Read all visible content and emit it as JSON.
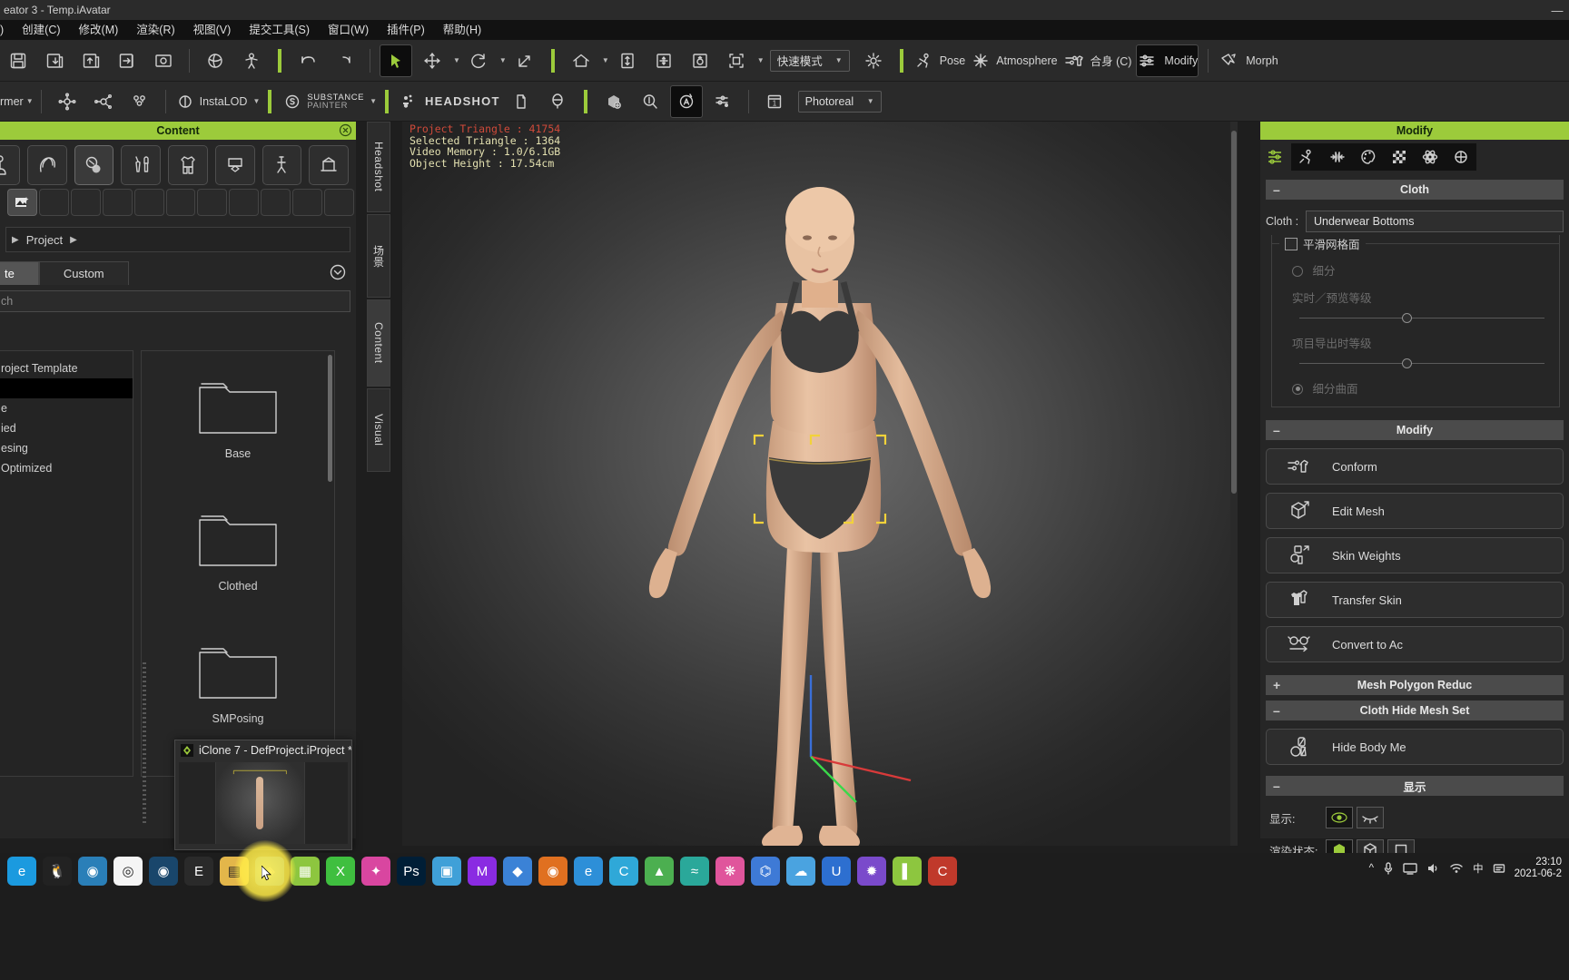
{
  "window": {
    "title": "eator 3 - Temp.iAvatar",
    "minimize": "—"
  },
  "menubar": {
    "items": [
      {
        "label": ")"
      },
      {
        "label": "创建(C)"
      },
      {
        "label": "修改(M)"
      },
      {
        "label": "渲染(R)"
      },
      {
        "label": "视图(V)"
      },
      {
        "label": "提交工具(S)"
      },
      {
        "label": "窗口(W)"
      },
      {
        "label": "插件(P)"
      },
      {
        "label": "帮助(H)"
      }
    ]
  },
  "toolbar_top": {
    "save_icon": "save-icon",
    "import_icon": "import-icon",
    "export_icon": "export-icon",
    "send_icon": "send-icon",
    "preview_icon": "preview-icon",
    "edit_icon": "edit-icon",
    "sphere_icon": "sphere-icon",
    "person_icon": "person-icon",
    "undo_icon": "undo-icon",
    "redo_icon": "redo-icon",
    "select_icon": "select-arrow-icon",
    "move_icon": "move-icon",
    "rotate_icon": "rotate-icon",
    "scale_icon": "scale-icon",
    "home_icon": "home-icon",
    "fit_icon": "fit-vertical-icon",
    "frame_icon": "frame-all-icon",
    "orbit_icon": "orbit-icon",
    "bounds_icon": "bounding-box-icon",
    "mode_label": "快速模式",
    "light_icon": "light-bulb-icon",
    "pose_label": "Pose",
    "pose_icon": "pose-icon",
    "atmosphere_label": "Atmosphere",
    "atmosphere_icon": "atmosphere-icon",
    "fit_label": "合身 (C)",
    "fit_tool_icon": "conform-icon",
    "modify_label": "Modify",
    "modify_icon": "modify-sliders-icon",
    "morph_label": "Morph",
    "morph_icon": "morph-icon"
  },
  "toolbar_second": {
    "former_label": "rmer",
    "instalod_label": "InstaLOD",
    "substance_label_1": "SUBSTANCE",
    "substance_label_2": "PAINTER",
    "headshot_label": "HEADSHOT",
    "render_mode": "Photoreal",
    "frame_number": "1",
    "icons": [
      "skingen-icon",
      "lighting-icon",
      "hair-icon",
      "facial-profile-icon",
      "head-icon",
      "texture-bake-icon",
      "inspect-icon",
      "auto-icon",
      "settings-icon"
    ]
  },
  "content_panel": {
    "title": "Content",
    "close_icon": "close-icon",
    "categories": [
      {
        "name": "avatar-icon"
      },
      {
        "name": "hair-icon"
      },
      {
        "name": "skin-icon"
      },
      {
        "name": "makeup-icon"
      },
      {
        "name": "cloth-icon"
      },
      {
        "name": "prop-icon"
      },
      {
        "name": "motion-icon"
      },
      {
        "name": "scene-icon"
      }
    ],
    "sub_first_icon": "image-plus-icon",
    "breadcrumb": "Project",
    "tabs": [
      {
        "label": "te",
        "active": true
      },
      {
        "label": "Custom",
        "active": false
      }
    ],
    "expand_icon": "chevron-down-circle-icon",
    "search_placeholder": "ch",
    "tree": [
      {
        "label": "roject Template",
        "selected": false
      },
      {
        "label": "",
        "selected": true
      },
      {
        "label": "e",
        "selected": false
      },
      {
        "label": "ied",
        "selected": false
      },
      {
        "label": "esing",
        "selected": false
      },
      {
        "label": "Optimized",
        "selected": false
      }
    ],
    "thumbnails": [
      {
        "label": "Base",
        "icon": "folder-icon"
      },
      {
        "label": "Clothed",
        "icon": "folder-icon"
      },
      {
        "label": "SMPosing",
        "icon": "folder-icon"
      }
    ],
    "bottom_left_icon": "sort-icon",
    "bottom_add": "+"
  },
  "dock_tabs": [
    {
      "label": "Headshot",
      "active": false
    },
    {
      "label": "场景",
      "active": false
    },
    {
      "label": "Content",
      "active": true
    },
    {
      "label": "Visual",
      "active": false
    }
  ],
  "viewport": {
    "stats": [
      {
        "text": "Project Triangle : 41754",
        "color": "#d04a3a"
      },
      {
        "text": "Selected Triangle : 1364",
        "color": "#e3e0b0"
      },
      {
        "text": "Video Memory : 1.0/6.1GB",
        "color": "#e3e0b0"
      },
      {
        "text": "Object Height : 17.54cm",
        "color": "#e3e0b0"
      }
    ]
  },
  "modify_panel": {
    "title": "Modify",
    "tab_icons": [
      "attribute-sliders-icon",
      "pose-icon",
      "morph-slider-icon",
      "material-icon",
      "checker-icon",
      "physics-icon",
      "more-icon"
    ],
    "cloth_section": {
      "header": "Cloth",
      "collapse": "–",
      "field_label": "Cloth :",
      "field_value": "Underwear Bottoms",
      "smooth_mesh_label": "平滑网格面",
      "subdivide_label": "细分",
      "realtime_label": "实时／预览等级",
      "export_label": "项目导出时等级",
      "subdiv_surface_label": "细分曲面"
    },
    "modify_section": {
      "header": "Modify",
      "collapse": "–",
      "buttons": [
        {
          "label": "Conform",
          "icon": "conform-icon"
        },
        {
          "label": "Edit Mesh",
          "icon": "edit-mesh-icon"
        },
        {
          "label": "Skin Weights",
          "icon": "skin-weights-icon"
        },
        {
          "label": "Transfer Skin",
          "icon": "transfer-skin-icon"
        },
        {
          "label": "Convert to Ac",
          "icon": "convert-accessory-icon"
        }
      ]
    },
    "polygon_section": {
      "header": "Mesh Polygon Reduc",
      "collapse": "+"
    },
    "hide_mesh_section": {
      "header": "Cloth Hide Mesh Set",
      "collapse": "–",
      "buttons": [
        {
          "label": "Hide Body Me",
          "icon": "hide-body-mesh-icon"
        }
      ]
    },
    "display_section": {
      "header": "显示",
      "collapse": "–",
      "rows": [
        {
          "label": "显示:",
          "toggles": [
            "eye-open-icon",
            "eye-closed-icon"
          ]
        },
        {
          "label": "渲染状态:",
          "toggles": [
            "solid-icon",
            "wireframe-icon",
            "box-icon"
          ]
        }
      ]
    }
  },
  "taskbar_preview": {
    "title": "iClone 7 - DefProject.iProject *",
    "icon": "iclone-icon"
  },
  "taskbar": {
    "apps": [
      {
        "name": "edge-icon",
        "color": "#1b9adf",
        "glyph": "e"
      },
      {
        "name": "penguin-icon",
        "color": "#222",
        "glyph": "🐧"
      },
      {
        "name": "photos-icon",
        "color": "#2a7fb8",
        "glyph": "◉"
      },
      {
        "name": "chrome-icon",
        "color": "#f5f5f5",
        "glyph": "◎"
      },
      {
        "name": "steam-icon",
        "color": "#19466b",
        "glyph": "◉"
      },
      {
        "name": "epic-icon",
        "color": "#2a2a2a",
        "glyph": "E"
      },
      {
        "name": "folder-icon",
        "color": "#e3b64a",
        "glyph": "▤"
      },
      {
        "name": "blue-app-icon",
        "color": "#2d7fd4",
        "glyph": "◈"
      },
      {
        "name": "cc3-icon",
        "color": "#8dc63f",
        "glyph": "▦"
      },
      {
        "name": "xsplit-icon",
        "color": "#3fbf3f",
        "glyph": "X"
      },
      {
        "name": "pink-app-icon",
        "color": "#d946a0",
        "glyph": "✦"
      },
      {
        "name": "photoshop-icon",
        "color": "#001e36",
        "glyph": "Ps"
      },
      {
        "name": "picture-icon",
        "color": "#3fa0d8",
        "glyph": "▣"
      },
      {
        "name": "m-app-icon",
        "color": "#8a2be2",
        "glyph": "M"
      },
      {
        "name": "blue-bird-icon",
        "color": "#3b82d6",
        "glyph": "◆"
      },
      {
        "name": "orange-app-icon",
        "color": "#e07020",
        "glyph": "◉"
      },
      {
        "name": "ms-edge-icon",
        "color": "#2d8fd8",
        "glyph": "e"
      },
      {
        "name": "c-app-icon",
        "color": "#2fa8d8",
        "glyph": "C"
      },
      {
        "name": "green-app-icon",
        "color": "#4caf50",
        "glyph": "▲"
      },
      {
        "name": "teal-app-icon",
        "color": "#2aa89a",
        "glyph": "≈"
      },
      {
        "name": "pink2-app-icon",
        "color": "#e0559c",
        "glyph": "❋"
      },
      {
        "name": "blue2-app-icon",
        "color": "#3e7ad6",
        "glyph": "⌬"
      },
      {
        "name": "cloud-app-icon",
        "color": "#4aa3e0",
        "glyph": "☁"
      },
      {
        "name": "u-app-icon",
        "color": "#2d6fd0",
        "glyph": "U"
      },
      {
        "name": "rainbow-app-icon",
        "color": "#7a4acb",
        "glyph": "✹"
      },
      {
        "name": "lime-app-icon",
        "color": "#8dc63f",
        "glyph": "▌"
      },
      {
        "name": "red-app-icon",
        "color": "#c0392b",
        "glyph": "C"
      }
    ],
    "tray": {
      "chevron": "^",
      "mic_icon": "mic-icon",
      "display_icon": "display-icon",
      "volume_icon": "volume-icon",
      "wifi_icon": "wifi-icon",
      "ime_label": "中",
      "ime_icon2": "ime-icon",
      "time": "23:10",
      "date": "2021-06-2"
    }
  }
}
